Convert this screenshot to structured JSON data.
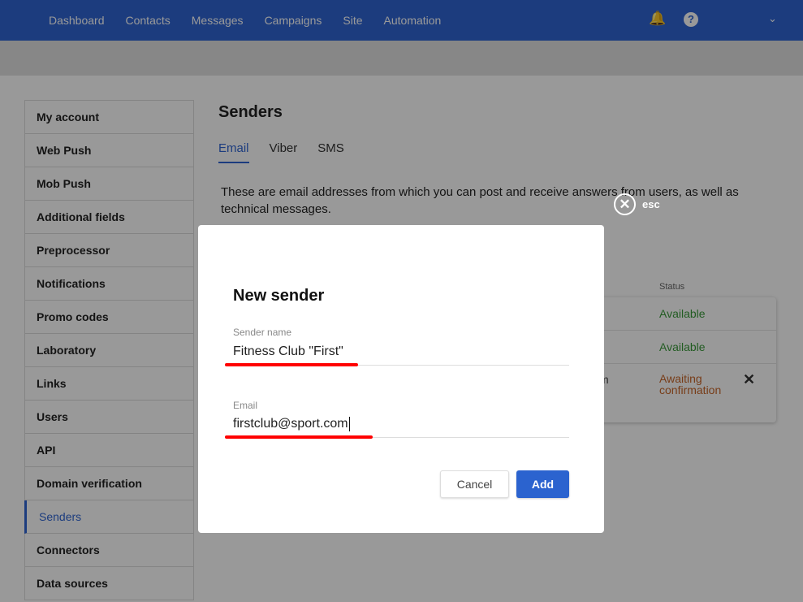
{
  "nav": {
    "items": [
      "Dashboard",
      "Contacts",
      "Messages",
      "Campaigns",
      "Site",
      "Automation"
    ],
    "icons": [
      "bell-icon",
      "help-icon",
      "chevron-down-icon"
    ]
  },
  "sidebar": {
    "items": [
      "My account",
      "Web Push",
      "Mob Push",
      "Additional fields",
      "Preprocessor",
      "Notifications",
      "Promo codes",
      "Laboratory",
      "Links",
      "Users",
      "API",
      "Domain verification",
      "Senders",
      "Connectors",
      "Data sources"
    ],
    "active": "Senders"
  },
  "page": {
    "title": "Senders",
    "tabs": [
      "Email",
      "Viber",
      "SMS"
    ],
    "active_tab": "Email",
    "description": "These are email addresses from which you can post and receive answers from users, as well as technical messages."
  },
  "table": {
    "status_header": "Status",
    "rows": [
      {
        "email_fragment": "",
        "status": "Available"
      },
      {
        "email_fragment": "",
        "status": "Available"
      },
      {
        "email_fragment": "m",
        "status": "Awaiting confirmation"
      }
    ]
  },
  "colors": {
    "accent": "#2f65d3",
    "available": "#3a9a3a",
    "awaiting": "#c8672a",
    "highlight": "#ff0000"
  },
  "esc_label": "esc",
  "modal": {
    "title": "New sender",
    "name_label": "Sender name",
    "name_value": "Fitness Club \"First\"",
    "email_label": "Email",
    "email_value": "firstclub@sport.com",
    "cancel": "Cancel",
    "add": "Add"
  }
}
